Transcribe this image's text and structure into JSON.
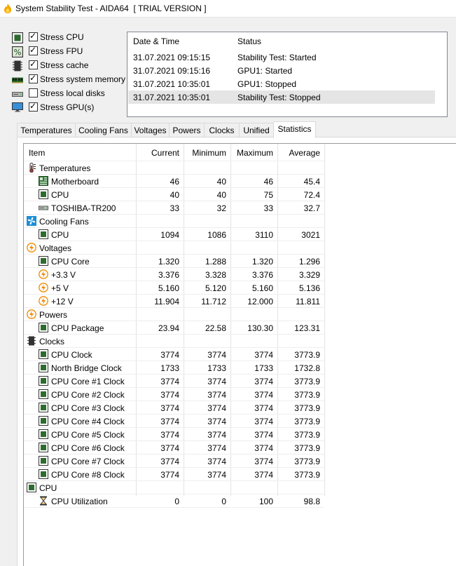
{
  "window": {
    "title": "System Stability Test - AIDA64  [ TRIAL VERSION ]"
  },
  "stress_options": [
    {
      "label": "Stress CPU",
      "checked": true,
      "icon": "cpu-chip-icon"
    },
    {
      "label": "Stress FPU",
      "checked": true,
      "icon": "fpu-icon"
    },
    {
      "label": "Stress cache",
      "checked": true,
      "icon": "cache-icon"
    },
    {
      "label": "Stress system memory",
      "checked": true,
      "icon": "memory-icon"
    },
    {
      "label": "Stress local disks",
      "checked": false,
      "icon": "disk-icon"
    },
    {
      "label": "Stress GPU(s)",
      "checked": true,
      "icon": "monitor-icon"
    }
  ],
  "log": {
    "columns": [
      "Date & Time",
      "Status"
    ],
    "rows": [
      {
        "date": "31.07.2021 09:15:15",
        "status": "Stability Test: Started"
      },
      {
        "date": "31.07.2021 09:15:16",
        "status": "GPU1: Started"
      },
      {
        "date": "31.07.2021 10:35:01",
        "status": "GPU1: Stopped"
      },
      {
        "date": "31.07.2021 10:35:01",
        "status": "Stability Test: Stopped"
      }
    ]
  },
  "tabs": [
    "Temperatures",
    "Cooling Fans",
    "Voltages",
    "Powers",
    "Clocks",
    "Unified",
    "Statistics"
  ],
  "active_tab": "Statistics",
  "stats": {
    "columns": [
      "Item",
      "Current",
      "Minimum",
      "Maximum",
      "Average"
    ],
    "rows": [
      {
        "group": true,
        "icon": "thermometer-icon",
        "name": "Temperatures"
      },
      {
        "icon": "motherboard-icon",
        "name": "Motherboard",
        "cur": "46",
        "min": "40",
        "max": "46",
        "avg": "45.4"
      },
      {
        "icon": "cpu-chip-icon",
        "name": "CPU",
        "cur": "40",
        "min": "40",
        "max": "75",
        "avg": "72.4"
      },
      {
        "icon": "disk-icon",
        "name": "TOSHIBA-TR200",
        "cur": "33",
        "min": "32",
        "max": "33",
        "avg": "32.7"
      },
      {
        "group": true,
        "icon": "fan-icon",
        "name": "Cooling Fans"
      },
      {
        "icon": "cpu-chip-icon",
        "name": "CPU",
        "cur": "1094",
        "min": "1086",
        "max": "3110",
        "avg": "3021"
      },
      {
        "group": true,
        "icon": "voltage-icon",
        "name": "Voltages"
      },
      {
        "icon": "cpu-chip-icon",
        "name": "CPU Core",
        "cur": "1.320",
        "min": "1.288",
        "max": "1.320",
        "avg": "1.296"
      },
      {
        "icon": "voltage-icon",
        "name": "+3.3 V",
        "cur": "3.376",
        "min": "3.328",
        "max": "3.376",
        "avg": "3.329"
      },
      {
        "icon": "voltage-icon",
        "name": "+5 V",
        "cur": "5.160",
        "min": "5.120",
        "max": "5.160",
        "avg": "5.136"
      },
      {
        "icon": "voltage-icon",
        "name": "+12 V",
        "cur": "11.904",
        "min": "11.712",
        "max": "12.000",
        "avg": "11.811"
      },
      {
        "group": true,
        "icon": "voltage-icon",
        "name": "Powers"
      },
      {
        "icon": "cpu-chip-icon",
        "name": "CPU Package",
        "cur": "23.94",
        "min": "22.58",
        "max": "130.30",
        "avg": "123.31"
      },
      {
        "group": true,
        "icon": "clock-chip-icon",
        "name": "Clocks"
      },
      {
        "icon": "cpu-chip-icon",
        "name": "CPU Clock",
        "cur": "3774",
        "min": "3774",
        "max": "3774",
        "avg": "3773.9"
      },
      {
        "icon": "cpu-chip-icon",
        "name": "North Bridge Clock",
        "cur": "1733",
        "min": "1733",
        "max": "1733",
        "avg": "1732.8"
      },
      {
        "icon": "cpu-chip-icon",
        "name": "CPU Core #1 Clock",
        "cur": "3774",
        "min": "3774",
        "max": "3774",
        "avg": "3773.9"
      },
      {
        "icon": "cpu-chip-icon",
        "name": "CPU Core #2 Clock",
        "cur": "3774",
        "min": "3774",
        "max": "3774",
        "avg": "3773.9"
      },
      {
        "icon": "cpu-chip-icon",
        "name": "CPU Core #3 Clock",
        "cur": "3774",
        "min": "3774",
        "max": "3774",
        "avg": "3773.9"
      },
      {
        "icon": "cpu-chip-icon",
        "name": "CPU Core #4 Clock",
        "cur": "3774",
        "min": "3774",
        "max": "3774",
        "avg": "3773.9"
      },
      {
        "icon": "cpu-chip-icon",
        "name": "CPU Core #5 Clock",
        "cur": "3774",
        "min": "3774",
        "max": "3774",
        "avg": "3773.9"
      },
      {
        "icon": "cpu-chip-icon",
        "name": "CPU Core #6 Clock",
        "cur": "3774",
        "min": "3774",
        "max": "3774",
        "avg": "3773.9"
      },
      {
        "icon": "cpu-chip-icon",
        "name": "CPU Core #7 Clock",
        "cur": "3774",
        "min": "3774",
        "max": "3774",
        "avg": "3773.9"
      },
      {
        "icon": "cpu-chip-icon",
        "name": "CPU Core #8 Clock",
        "cur": "3774",
        "min": "3774",
        "max": "3774",
        "avg": "3773.9"
      },
      {
        "group": true,
        "icon": "cpu-chip-icon",
        "name": "CPU"
      },
      {
        "icon": "hourglass-icon",
        "name": "CPU Utilization",
        "cur": "0",
        "min": "0",
        "max": "100",
        "avg": "98.8"
      }
    ]
  },
  "colors": {
    "fan_blue": "#1c8fd6",
    "volt_orange": "#f08a00",
    "chip_green": "#2e6b2e",
    "thermo_red": "#c0392b"
  }
}
